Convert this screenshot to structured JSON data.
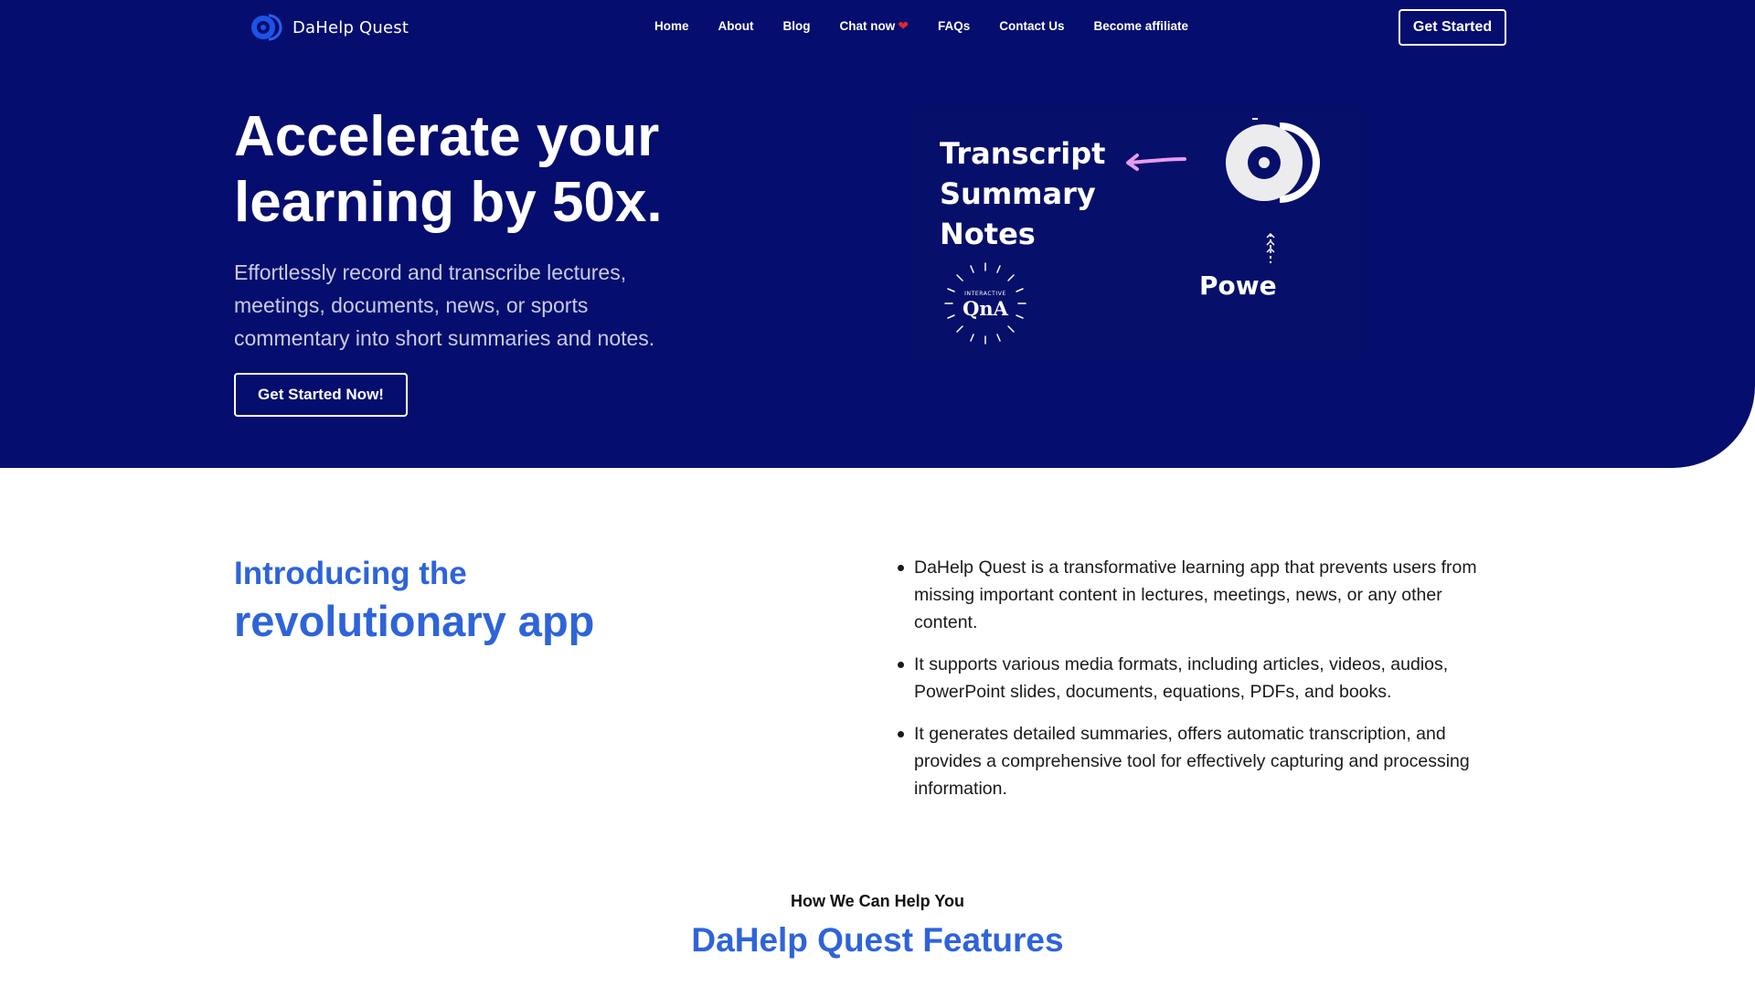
{
  "brand": {
    "name": "DaHelp Quest"
  },
  "nav": {
    "items": [
      {
        "label": "Home"
      },
      {
        "label": "About"
      },
      {
        "label": "Blog"
      },
      {
        "label": "Chat now"
      },
      {
        "label": "FAQs"
      },
      {
        "label": "Contact Us"
      },
      {
        "label": "Become affiliate"
      }
    ],
    "cta_label": "Get Started"
  },
  "hero": {
    "title": "Accelerate your learning by 50x.",
    "subtitle": "Effortlessly record and transcribe lectures, meetings, documents, news, or sports commentary into short summaries and notes.",
    "cta_label": "Get Started Now!",
    "art": {
      "words": [
        "Transcript",
        "Summary",
        "Notes"
      ],
      "partial_word": "Powe",
      "badge_small": "INTERACTIVE",
      "badge_main": "QnA"
    }
  },
  "intro": {
    "heading_line1": "Introducing the",
    "heading_line2": "revolutionary app",
    "bullets": [
      "DaHelp Quest is a transformative learning app that prevents users from missing important content in lectures, meetings, news, or any other content.",
      "It supports various media formats, including articles, videos, audios, PowerPoint slides, documents, equations, PDFs, and books.",
      "It generates detailed summaries, offers automatic transcription, and provides a comprehensive tool for effectively capturing and processing information."
    ]
  },
  "features": {
    "kicker": "How We Can Help You",
    "title": "DaHelp Quest Features"
  },
  "colors": {
    "hero_bg": "#050e6e",
    "accent_blue": "#2e64d9",
    "heart": "#e3262f",
    "arrow_pink": "#e79cf0"
  },
  "icons": {
    "logo": "dahelp-logo-icon",
    "heart": "heart-icon"
  }
}
